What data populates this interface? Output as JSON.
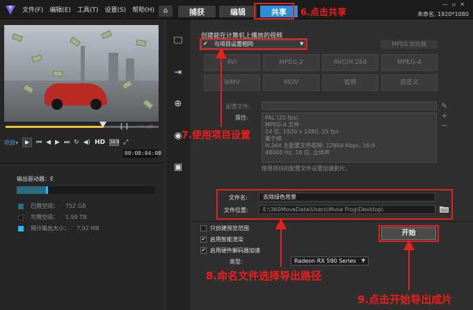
{
  "menu": {
    "file": "文件(F)",
    "edit": "编辑(E)",
    "tools": "工具(T)",
    "settings": "设置(S)",
    "help": "帮助(H)"
  },
  "tabs": {
    "capture": "捕获",
    "edit": "编辑",
    "share": "共享"
  },
  "project_info": "未命名, 1920*1080",
  "annotations": {
    "step6": "6.点击共享",
    "step7": "7.使用项目设置",
    "step8": "8.命名文件选择导出路径",
    "step9": "9.点击开始导出成片"
  },
  "player": {
    "project_label": "项目▾",
    "hd": "HD",
    "ratio": "16:9",
    "timecode": "00:00:04:00"
  },
  "output": {
    "drive_label": "输出驱动器：",
    "drive_letter": "E",
    "used_fraction": 0.21,
    "legend": [
      {
        "label": "已用空间：",
        "value": "752 GB",
        "color": "#2b6a80"
      },
      {
        "label": "可用空间：",
        "value": "1.99 TB",
        "color": "#1a1a1a"
      },
      {
        "label": "预计输出大小：",
        "value": "7.92 MB",
        "color": "#27b8f5"
      }
    ]
  },
  "share": {
    "section_title": "创建能在计算机上播放的视频",
    "profile_select": "与项目设置相同",
    "mpeg_options": "MPEG 优化器",
    "formats": [
      "AVI",
      "MPEG-2",
      "AVC/H.264",
      "MPEG-4",
      "WMV",
      "MOV",
      "音频",
      "自定义"
    ],
    "config_label": "配置文件:",
    "properties_label": "属性:",
    "properties": [
      "PAL (25 fps)",
      "MPEG-4 文件",
      "24 位, 1920 x 1080, 25 fps",
      "基于帧",
      "H.264 主配置文件视频: 12804 Kbps, 16:9",
      "48000 Hz, 16 位, 立体声"
    ],
    "note": "使用项目的配置文件设置创建影片。",
    "filename_label": "文件名:",
    "filename_value": "去除绿色背景",
    "location_label": "文件位置:",
    "location_value": "E:\\360MoveData\\Users\\Muse Frog\\Desktop\\",
    "options": {
      "preview_only": "只创建预览范围",
      "smart_render": "启用智能渲染",
      "hw_decoder": "启用硬件解码器加速"
    },
    "type_label": "类型:",
    "type_value": "Radeon RX 590 Series",
    "start_button": "开始"
  }
}
